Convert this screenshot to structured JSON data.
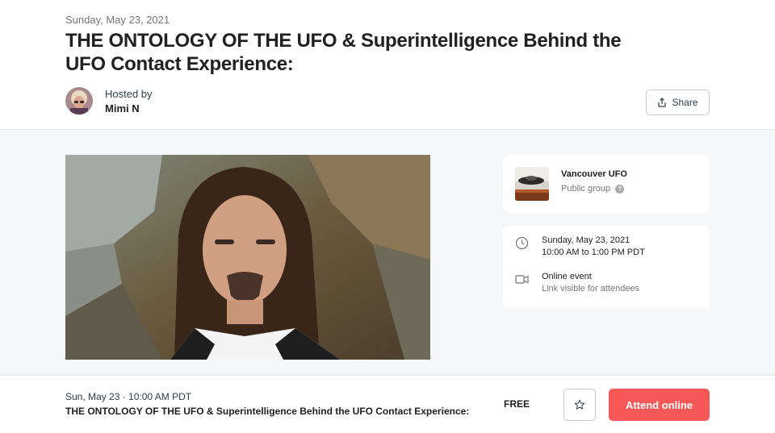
{
  "header": {
    "date": "Sunday, May 23, 2021",
    "title": "THE ONTOLOGY OF THE UFO & Superintelligence Behind the UFO Contact Experience:",
    "hosted_by_label": "Hosted by",
    "host_name": "Mimi N",
    "share_label": "Share"
  },
  "group": {
    "name": "Vancouver UFO",
    "type": "Public group",
    "help_glyph": "?"
  },
  "event_info": {
    "date": "Sunday, May 23, 2021",
    "time": "10:00 AM to 1:00 PM PDT",
    "location_title": "Online event",
    "location_note": "Link visible for attendees"
  },
  "footer": {
    "date_time": "Sun, May 23 · 10:00 AM PDT",
    "title": "THE ONTOLOGY OF THE UFO & Superintelligence Behind the UFO Contact Experience:",
    "price": "FREE",
    "attend_label": "Attend online"
  },
  "icons": {
    "share": "share-icon",
    "clock": "clock-icon",
    "video": "video-camera-icon",
    "star": "star-icon"
  },
  "colors": {
    "accent": "#f65858",
    "text_dark": "#212121",
    "text_muted": "#757575",
    "page_bg": "#f6f7f8"
  }
}
